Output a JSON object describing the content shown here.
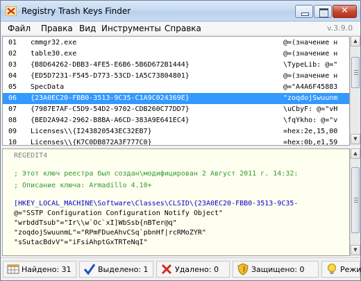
{
  "window": {
    "title": "Registry Trash Keys Finder",
    "version": "v.3.9.0"
  },
  "menu": [
    "Файл",
    "Правка",
    "Вид",
    "Инструменты",
    "Справка"
  ],
  "rows": [
    {
      "idx": "01",
      "name": "cmmgr32.exe",
      "val": "@=(значение н"
    },
    {
      "idx": "02",
      "name": "table30.exe",
      "val": "@=(значение н"
    },
    {
      "idx": "03",
      "name": "{B8D64262-DBB3-4FE5-E6B6-5B6D672B1444}",
      "val": "\\TypeLib: @=\""
    },
    {
      "idx": "04",
      "name": "{ED5D7231-F545-D773-53CD-1A5C73804801}",
      "val": "@=(значение н"
    },
    {
      "idx": "05",
      "name": "SpecData",
      "val": "@=\"A4A6F45883"
    },
    {
      "idx": "06",
      "name": "{23A0EC20-FBB0-3513-9C35-C1A9C024369E}",
      "val": "\"zoqdojSwuunm"
    },
    {
      "idx": "07",
      "name": "{7987E7AF-C5D9-54D2-9702-CDB260C77DD7}",
      "val": "\\uCbyF: @=\"vH"
    },
    {
      "idx": "08",
      "name": "{BED2A942-2962-B8BA-A6CD-383A9E641EC4}",
      "val": "\\fqYkho: @=\"v"
    },
    {
      "idx": "09",
      "name": "Licenses\\\\{I243820543EC32EB7}",
      "val": "=hex:2e,15,00"
    },
    {
      "idx": "10",
      "name": "Licenses\\\\{K7C0DB872A3F777C0}",
      "val": "=hex:0b,e1,59"
    }
  ],
  "selected_row": "06",
  "reg": {
    "header": "REGEDIT4",
    "comment1": "; Этот ключ реестра был создан\\модифицирован 2 Август 2011 г. 14:32:",
    "comment2": "; Описание ключа: Armadillo 4.10+",
    "key": "[HKEY_LOCAL_MACHINE\\Software\\Classes\\CLSID\\{23A0EC20-FBB0-3513-9C35-",
    "line1": "@=\"SSTP Configuration Configuration Notify Object\"",
    "line2": "\"wrbddTsub\"=\"Ir\\\\w`Oc`xI]WbSsb{nBTer@q\"",
    "line3": "\"zoqdojSwuunmL\"=\"RPmFDueAhvCSq`pbnHf|rcRMoZYR\"",
    "line4": "\"sSutacBdvV\"=\"iFsiAhptGxTRTeNqI\""
  },
  "status": {
    "found": "Найдено: 31",
    "selected": "Выделено: 1",
    "deleted": "Удалено: 0",
    "protected": "Защищено: 0",
    "mode": "Режи"
  }
}
